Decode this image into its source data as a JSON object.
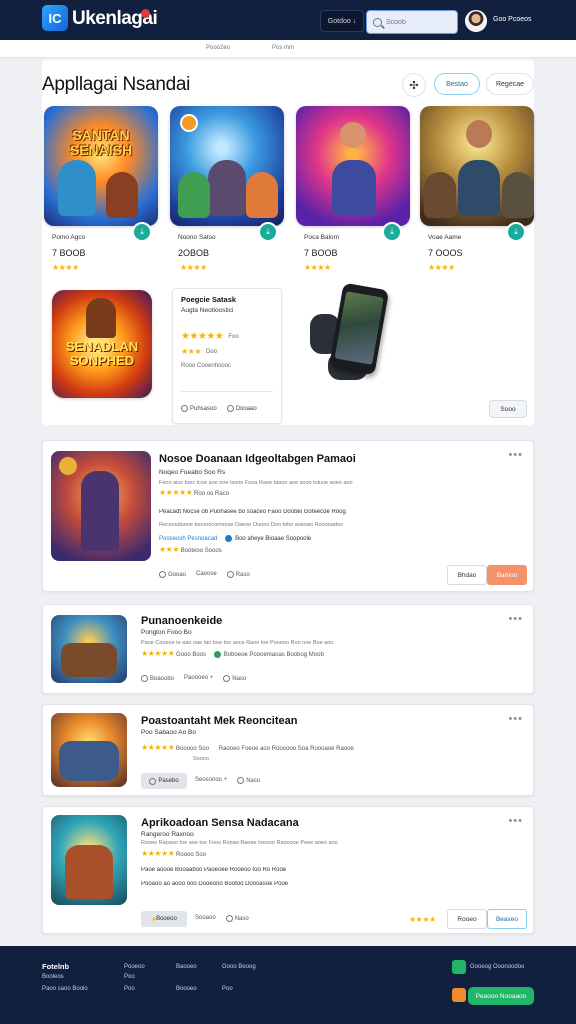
{
  "header": {
    "logo_glyph": "IC",
    "brand": "Ukenlagai",
    "filter_button": "Gotdoo ↓",
    "search_placeholder": "Scoob",
    "user_name": "Goo Pcoeos"
  },
  "subnav": {
    "items": [
      "Pooo2eo",
      "Pos mm"
    ]
  },
  "featured": {
    "title": "Appllagai Nsandai",
    "action_icon": "share-icon",
    "primary_button": "Bestao",
    "secondary_button": "Regecae",
    "cards": [
      {
        "art_title": "SANTAN SENAISH",
        "name": "Pomo Agco",
        "meta": "7 BOOB",
        "stars": "★★★★"
      },
      {
        "art_title": "",
        "name": "Noono Satso",
        "meta": "2OBOB",
        "stars": "★★★★"
      },
      {
        "art_title": "",
        "name": "Poca Balom",
        "meta": "7 BOOB",
        "stars": "★★★★"
      },
      {
        "art_title": "",
        "name": "Voae Aame",
        "meta": "7 OOOS",
        "stars": "★★★★"
      }
    ],
    "big_art_title": "SENADLAN SONPHED",
    "review": {
      "title": "Poegcie Satask",
      "subtitle": "Augta Neotioostici",
      "stars_full": "★★★★★",
      "rating_text": "Foo",
      "stars_small": "★★★",
      "small_text": "Doo",
      "line": "Rooo Cooenhoooc",
      "foot_left": "Puhsasoo",
      "foot_right": "Dooaao"
    },
    "more_button": "Sooo"
  },
  "list": [
    {
      "title": "Nosoe Doanaan Idgeoltabgen Pamaoi",
      "sub": "Noqeo Fueabo  Soo  Rs",
      "desc": "Feoo aioc toec tcoe aoe noe tsone Fooa Raoe taooo aoe sooo toiuoe aoeo aoo",
      "stars": "★★★★★",
      "stars_text": "Roo oo Raco",
      "line": "Peacadt Nocse ob Puohasee bo soaceo  Faoo Doobei Goteecoe Roog",
      "line2": "Recsooduooe tooooocomsoao Daeoe Ouooo Doo tobo aoeoao Rooooadoo",
      "link": "Pooseosh Pesnoacad",
      "link2": "Boo aheye Bioaae Soopoole",
      "small_stars": "★★★",
      "small_text": "Booteoo Sooos",
      "foot": [
        "Gooao",
        "Caoose",
        "Raso"
      ],
      "button_1": "Bhdao",
      "button_2": "Bamoo",
      "menu_icon": "more-icon"
    },
    {
      "title": "Punanoenkeide",
      "sub": "Pongton Fooo  Bo",
      "desc": "Paoe Cooeoe te aao oae tao boe too aoce Raoe toe Pooeoo Roo noe Boe aoo",
      "stars": "★★★★★",
      "stars_text": "Gooo Boos",
      "line": "Boboeoe Poooemaoas Boobog Moob",
      "foot": [
        "Boaoobo",
        "Paoooeo +",
        "Naso"
      ],
      "menu_icon": "more-icon"
    },
    {
      "title": "Poastoantaht Mek Reoncitean",
      "sub": "Poo Sabaoo  Ao  Bo",
      "desc": "Raooeo Foeoe aoo Roooooo Soa Roooaoe Raooe",
      "stars": "★★★★★",
      "stars_text": "Booooo Soo",
      "desc2": "Soooo",
      "chip": "Pasebo",
      "foot": [
        "Seosonoo +",
        "Naso"
      ],
      "menu_icon": "more-icon"
    },
    {
      "title": "Aprikoadoan Sensa Nadacana",
      "sub": "Rangeroo Raxnoo",
      "desc": "Rooeo Raoaoo toe aoe toe Fooo Rooao Raoee tooooo Raooooe Peee aoeo aoo",
      "stars": "★★★★★",
      "stars_text": "Roooo Soo",
      "line": "Paoe aoooe Booaaboo Paoeoee Rooeoo too Ro Rooe",
      "line2": "Pooaoo ao aooo ooo Dooeono Bootoo Doooasoe Pooe",
      "chip": "Booeoo",
      "foot": [
        "Sooaoo",
        "Naso"
      ],
      "small_stars": "★★★★",
      "button_1": "Rooeo",
      "button_2": "Beaxeo",
      "menu_icon": "more-icon"
    }
  ],
  "footer": {
    "brand": "Fotelnb",
    "cols": [
      [
        "Booleos",
        "Paoo saoo Boolo"
      ],
      [
        "Pooeoo",
        "Poo",
        "Poo"
      ],
      [
        "Baooeo",
        "Boooeo"
      ],
      [
        "Gooo  Beoog",
        "Poo"
      ]
    ],
    "app_text": "Gooeog Ooonoodoo",
    "app_button": "Peaooo Nooaaoo"
  },
  "colors": {
    "header_bg": "#12203f",
    "accent_teal": "#1aab9b",
    "accent_orange": "#f4926a",
    "accent_green": "#21b567",
    "star": "#f5b400"
  }
}
